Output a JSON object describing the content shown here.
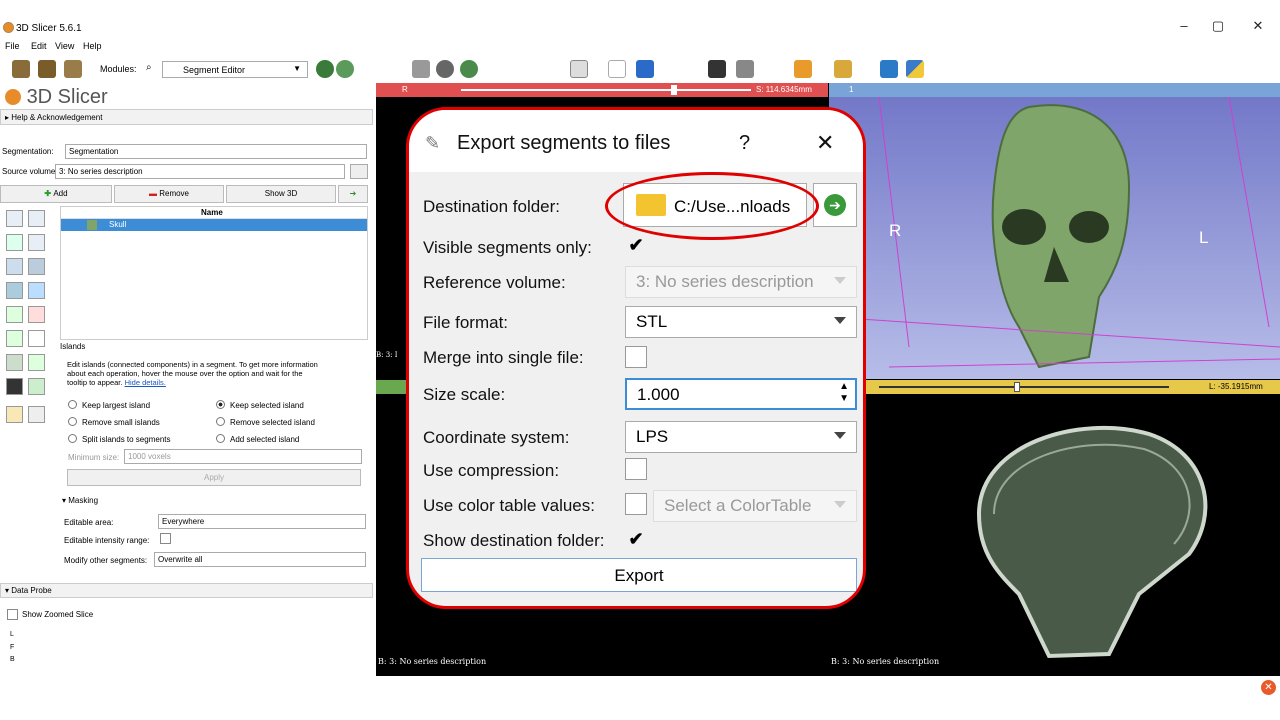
{
  "window": {
    "title": "3D Slicer 5.6.1",
    "minimize": "–",
    "maximize": "▢",
    "close": "✕"
  },
  "menu": {
    "file": "File",
    "edit": "Edit",
    "view": "View",
    "help": "Help"
  },
  "toolbar": {
    "modules_label": "Modules:",
    "module_value": "Segment Editor"
  },
  "left": {
    "logo": "3D Slicer",
    "help_ack": "Help & Acknowledgement",
    "segmentation_label": "Segmentation:",
    "segmentation_value": "Segmentation",
    "source_label": "Source volume:",
    "source_value": "3: No series description",
    "add": "Add",
    "remove": "Remove",
    "show3d": "Show 3D",
    "table_header": "Name",
    "segment": "Skull",
    "islands_title": "Islands",
    "islands_desc1": "Edit islands (connected components) in a segment. To get more information",
    "islands_desc2": "about each operation, hover the mouse over the option and wait for the",
    "islands_desc3": "tooltip to appear.",
    "hide_details": "Hide details.",
    "opt_keep_largest": "Keep largest island",
    "opt_keep_selected": "Keep selected island",
    "opt_remove_small": "Remove small islands",
    "opt_remove_selected": "Remove selected island",
    "opt_split": "Split islands to segments",
    "opt_add_selected": "Add selected island",
    "min_size_label": "Minimum size:",
    "min_size_value": "1000 voxels",
    "apply": "Apply",
    "masking": "Masking",
    "editable_area_label": "Editable area:",
    "editable_area_value": "Everywhere",
    "editable_intensity_label": "Editable intensity range:",
    "modify_other_label": "Modify other segments:",
    "modify_other_value": "Overwrite all",
    "data_probe": "Data Probe",
    "show_zoomed": "Show Zoomed Slice",
    "probe_l": "L",
    "probe_f": "F",
    "probe_b": "B"
  },
  "views": {
    "red_value": "S: 114.6345mm",
    "red_bottom": "B: 3: No series description",
    "red_side": "B: 3: I",
    "threed_id": "1",
    "label_r": "R",
    "label_l": "L",
    "yellow_value": "L: -35.1915mm",
    "yellow_bottom": "B: 3: No series description",
    "red_letter": "R"
  },
  "dialog": {
    "title": "Export segments to files",
    "help": "?",
    "close": "✕",
    "dest_label": "Destination folder:",
    "dest_value": "C:/Use...nloads",
    "visible_label": "Visible segments only:",
    "visible_checked": "✔",
    "refvol_label": "Reference volume:",
    "refvol_value": "3: No series description",
    "format_label": "File format:",
    "format_value": "STL",
    "merge_label": "Merge into single file:",
    "scale_label": "Size scale:",
    "scale_value": "1.000",
    "coord_label": "Coordinate system:",
    "coord_value": "LPS",
    "compress_label": "Use compression:",
    "colortable_label": "Use color table values:",
    "colortable_value": "Select a ColorTable",
    "showdest_label": "Show destination folder:",
    "showdest_checked": "✔",
    "export": "Export"
  },
  "colors": {
    "accent_red": "#e00000",
    "selection_blue": "#3c8dd6",
    "skull_green": "#7fa56a",
    "slice_red": "#e05050",
    "slice_yellow": "#e6c84a"
  }
}
